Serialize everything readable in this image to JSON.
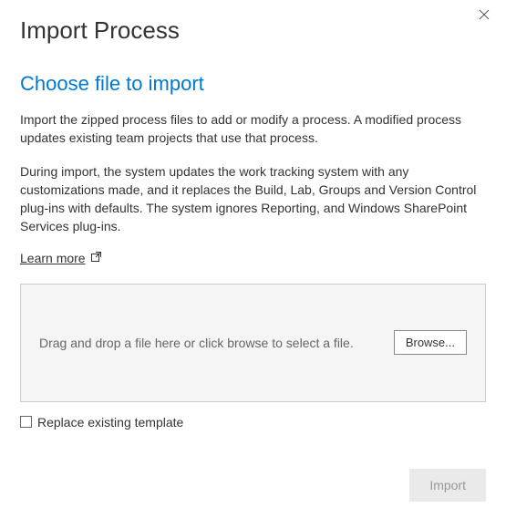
{
  "dialog": {
    "title": "Import Process"
  },
  "section": {
    "header": "Choose file to import",
    "paragraph1": "Import the zipped process files to add or modify a process. A modified process updates existing team projects that use that process.",
    "paragraph2": "During import, the system updates the work tracking system with any customizations made, and it replaces the Build, Lab, Groups and Version Control plug-ins with defaults. The system ignores Reporting, and Windows SharePoint Services plug-ins.",
    "learn_more_label": "Learn more"
  },
  "dropzone": {
    "instruction": "Drag and drop a file here or click browse to select a file.",
    "browse_label": "Browse..."
  },
  "options": {
    "replace_label": "Replace existing template"
  },
  "actions": {
    "import_label": "Import"
  }
}
